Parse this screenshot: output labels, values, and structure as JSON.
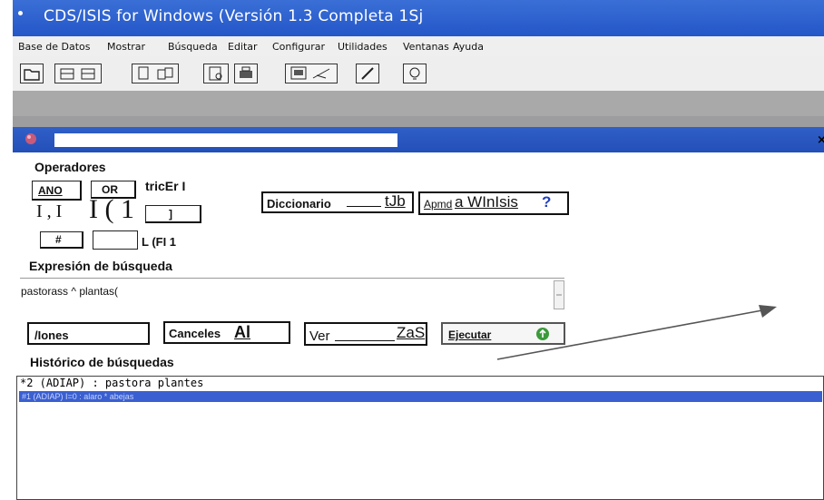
{
  "window": {
    "title": "CDS/ISIS for Windows (Versión 1.3 Completa 1Sj"
  },
  "menu": {
    "items": [
      "Base de Datos",
      "Mostrar",
      "Búsqueda",
      "Editar",
      "Configurar",
      "Utilidades",
      "Ventanas",
      "Ayuda"
    ]
  },
  "toolbar": {
    "icons": [
      "open-folder-icon",
      "database-icon",
      "database-alt-icon",
      "copy-icon",
      "paste-icon",
      "print-preview-icon",
      "printer-icon",
      "screen-icon",
      "edit-pen-icon",
      "pencil-icon",
      "lightbulb-icon"
    ]
  },
  "search": {
    "operators_label": "Operadores",
    "op_and": "ANO",
    "op_or": "OR",
    "op_extra": "tricEr I",
    "row2_left": "I , I",
    "row2_paren": "I ( 1",
    "row2_btn": "]",
    "op_hash": "#",
    "row3_right": "L (FI 1",
    "dict_label": "Diccionario",
    "dict_suffix": "tJb",
    "help_prefix": "Apmd",
    "help_main": "a WInIsis",
    "help_q": "?",
    "expr_label": "Expresión de búsqueda",
    "expr_value": "pastorass ^ plantas(",
    "btn_iones": "/Iones",
    "btn_cancel": "Canceles",
    "btn_cancel_suffix": "Al",
    "btn_ver": "Ver",
    "btn_ver_suffix": "ZaS",
    "btn_run": "Ejecutar",
    "history_label": "Histórico de búsquedas",
    "history": [
      "*2 (ADIAP)    : pastora plantes",
      "#1 (ADIAP) I=0 : alaro * abejas"
    ]
  }
}
